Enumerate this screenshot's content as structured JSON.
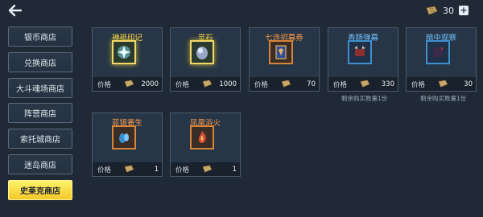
{
  "header": {
    "currency_amount": "30",
    "plus_label": "+"
  },
  "sidebar": {
    "items": [
      {
        "label": "银币商店",
        "active": false
      },
      {
        "label": "兑换商店",
        "active": false
      },
      {
        "label": "大斗魂场商店",
        "active": false
      },
      {
        "label": "阵营商店",
        "active": false
      },
      {
        "label": "索托城商店",
        "active": false
      },
      {
        "label": "迷岛商店",
        "active": false
      },
      {
        "label": "史莱克商店",
        "active": true
      }
    ]
  },
  "shop": {
    "price_label": "价格",
    "items": [
      {
        "name": "神祇印记",
        "price": "2000",
        "rarity": "gold",
        "icon": "divine-mark-icon"
      },
      {
        "name": "灵石",
        "price": "1000",
        "rarity": "gold",
        "icon": "spirit-stone-icon"
      },
      {
        "name": "七连招募券",
        "price": "70",
        "rarity": "orange",
        "icon": "recruit-ticket-icon"
      },
      {
        "name": "香肠弹幕",
        "price": "330",
        "rarity": "blue",
        "icon": "sausage-barrage-icon",
        "remain": "剩余购买数量1份"
      },
      {
        "name": "暗中观察",
        "price": "30",
        "rarity": "blue",
        "icon": "secret-observe-icon",
        "remain": "剩余购买数量1份"
      },
      {
        "name": "蓝银寄生",
        "price": "1",
        "rarity": "orange",
        "icon": "bluesilver-parasite-icon"
      },
      {
        "name": "凤凰浴火",
        "price": "1",
        "rarity": "orange",
        "icon": "phoenix-fire-icon"
      }
    ]
  },
  "colors": {
    "background": "#1f2a36",
    "active_tab": "#f4c82a",
    "gold_title": "#ffd84a",
    "orange_title": "#ff9a4a",
    "blue_title": "#6fc0ff"
  }
}
